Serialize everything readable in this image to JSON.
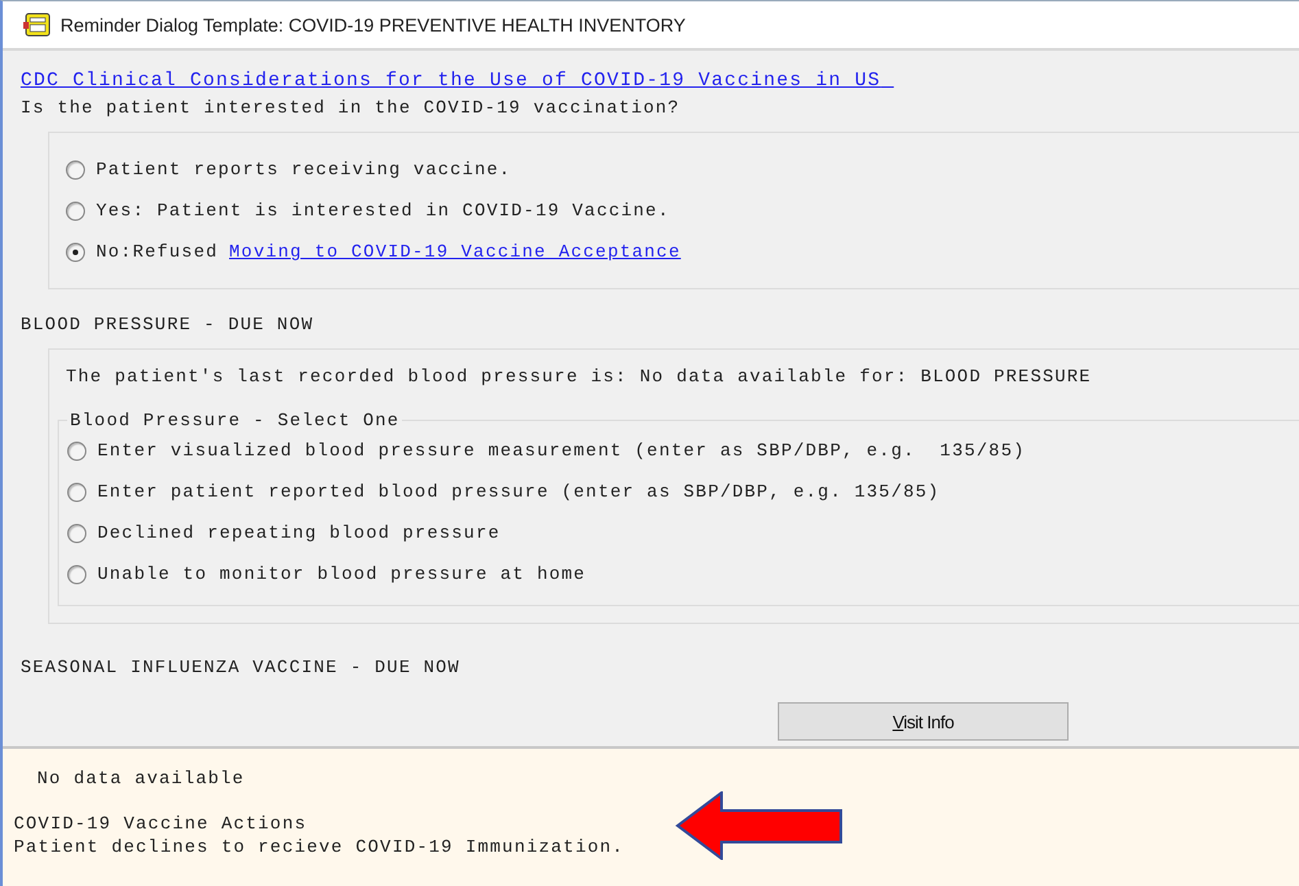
{
  "window": {
    "title": "Reminder Dialog Template: COVID-19 PREVENTIVE HEALTH INVENTORY"
  },
  "reference_link": "CDC Clinical Considerations for the Use of COVID-19 Vaccines in US",
  "vaccine_question": {
    "prompt": "Is the patient interested in the COVID-19 vaccination?",
    "options": [
      {
        "label": "Patient reports receiving vaccine.",
        "selected": false
      },
      {
        "label": "Yes: Patient is interested in COVID-19 Vaccine.",
        "selected": false
      },
      {
        "label": "No:Refused",
        "selected": true,
        "link": "Moving to COVID-19 Vaccine Acceptance"
      }
    ]
  },
  "blood_pressure": {
    "heading": "BLOOD PRESSURE - DUE NOW",
    "note": "The patient's last recorded blood pressure is: No data available for: BLOOD PRESSURE",
    "group_label": "Blood Pressure - Select One",
    "options": [
      {
        "label": "Enter visualized blood pressure measurement (enter as SBP/DBP, e.g.  135/85)",
        "selected": false
      },
      {
        "label": "Enter patient reported blood pressure (enter as SBP/DBP, e.g. 135/85)",
        "selected": false
      },
      {
        "label": "Declined repeating blood pressure",
        "selected": false
      },
      {
        "label": "Unable to monitor blood pressure at home",
        "selected": false
      }
    ]
  },
  "influenza": {
    "heading": "SEASONAL INFLUENZA VACCINE - DUE NOW"
  },
  "visit_info_button": "Visit Info",
  "summary": {
    "no_data": "No data available",
    "action_heading": "COVID-19 Vaccine Actions",
    "action_text": "Patient declines to recieve COVID-19 Immunization."
  }
}
